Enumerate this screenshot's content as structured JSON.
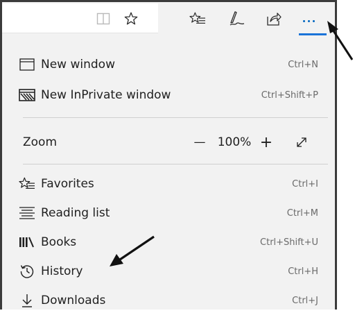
{
  "menu": {
    "new_window": {
      "label": "New window",
      "shortcut": "Ctrl+N",
      "icon": "window-icon"
    },
    "new_inprivate": {
      "label": "New InPrivate window",
      "shortcut": "Ctrl+Shift+P",
      "icon": "inprivate-icon"
    },
    "zoom": {
      "label": "Zoom",
      "minus": "—",
      "value": "100%",
      "plus": "+",
      "fullscreen_icon": "fullscreen-icon"
    },
    "favorites": {
      "label": "Favorites",
      "shortcut": "Ctrl+I",
      "icon": "favorites-icon"
    },
    "reading_list": {
      "label": "Reading list",
      "shortcut": "Ctrl+M",
      "icon": "reading-list-icon"
    },
    "books": {
      "label": "Books",
      "shortcut": "Ctrl+Shift+U",
      "icon": "books-icon"
    },
    "history": {
      "label": "History",
      "shortcut": "Ctrl+H",
      "icon": "history-icon"
    },
    "downloads": {
      "label": "Downloads",
      "shortcut": "Ctrl+J",
      "icon": "downloads-icon"
    }
  },
  "toolbar": {
    "icons": [
      "reading-view-icon",
      "favorite-star-icon",
      "favorites-hub-icon",
      "web-note-icon",
      "share-icon",
      "more-actions-icon"
    ]
  },
  "colors": {
    "accent": "#1a73d8",
    "menu_bg": "#f2f2f2",
    "shortcut_text": "#6a6a6a"
  }
}
